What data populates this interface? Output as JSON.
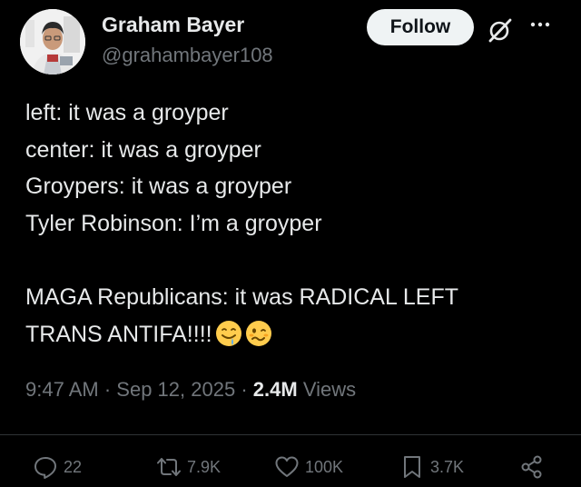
{
  "user": {
    "name": "Graham Bayer",
    "handle": "@grahambayer108"
  },
  "follow_label": "Follow",
  "tweet": {
    "lines": [
      "left: it was a groyper",
      "center: it was a groyper",
      "Groypers: it was a groyper",
      "Tyler Robinson: I’m a groyper",
      "",
      "MAGA Republicans: it was RADICAL LEFT",
      "TRANS ANTIFA!!!!"
    ],
    "emojis": [
      "drooling-face-emoji",
      "woozy-face-emoji"
    ]
  },
  "meta": {
    "time": "9:47 AM",
    "date": "Sep 12, 2025",
    "views_count": "2.4M",
    "views_label": "Views"
  },
  "actions": {
    "replies": "22",
    "reposts": "7.9K",
    "likes": "100K",
    "bookmarks": "3.7K"
  },
  "icons": {
    "grok": "grok-icon",
    "more": "more-icon",
    "reply": "reply-icon",
    "repost": "repost-icon",
    "like": "heart-icon",
    "bookmark": "bookmark-icon",
    "share": "share-icon"
  },
  "colors": {
    "background": "#000000",
    "text": "#e7e9ea",
    "secondary": "#71767b",
    "button_bg": "#eff3f4",
    "button_text": "#0f1419"
  }
}
